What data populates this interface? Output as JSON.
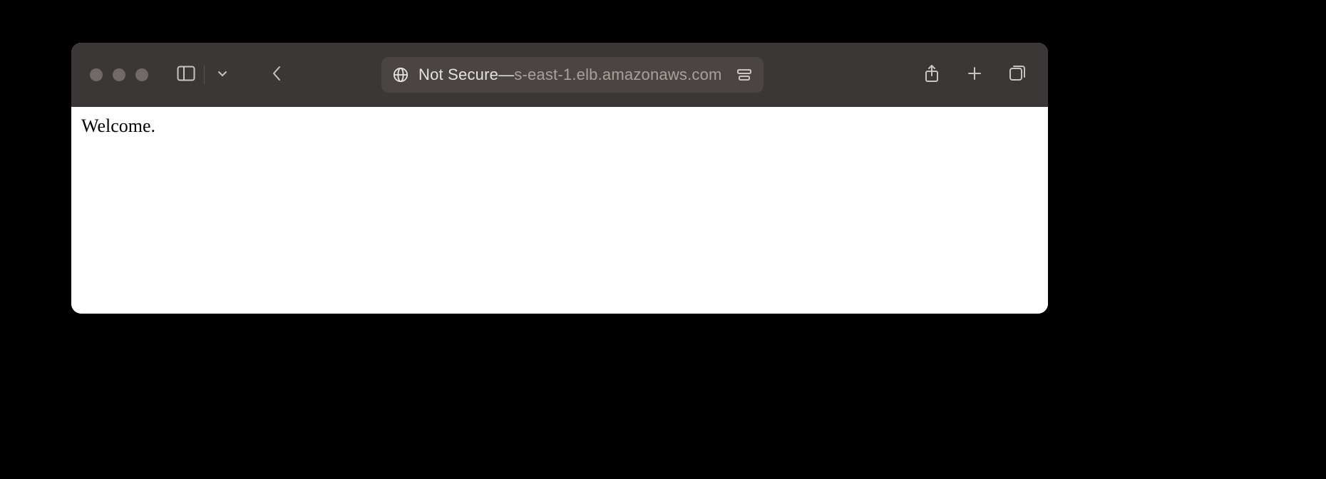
{
  "toolbar": {
    "address": {
      "security_label": "Not Secure",
      "separator": " — ",
      "host_suffix": "s-east-1.elb.amazonaws.com"
    }
  },
  "page": {
    "body_text": "Welcome."
  }
}
